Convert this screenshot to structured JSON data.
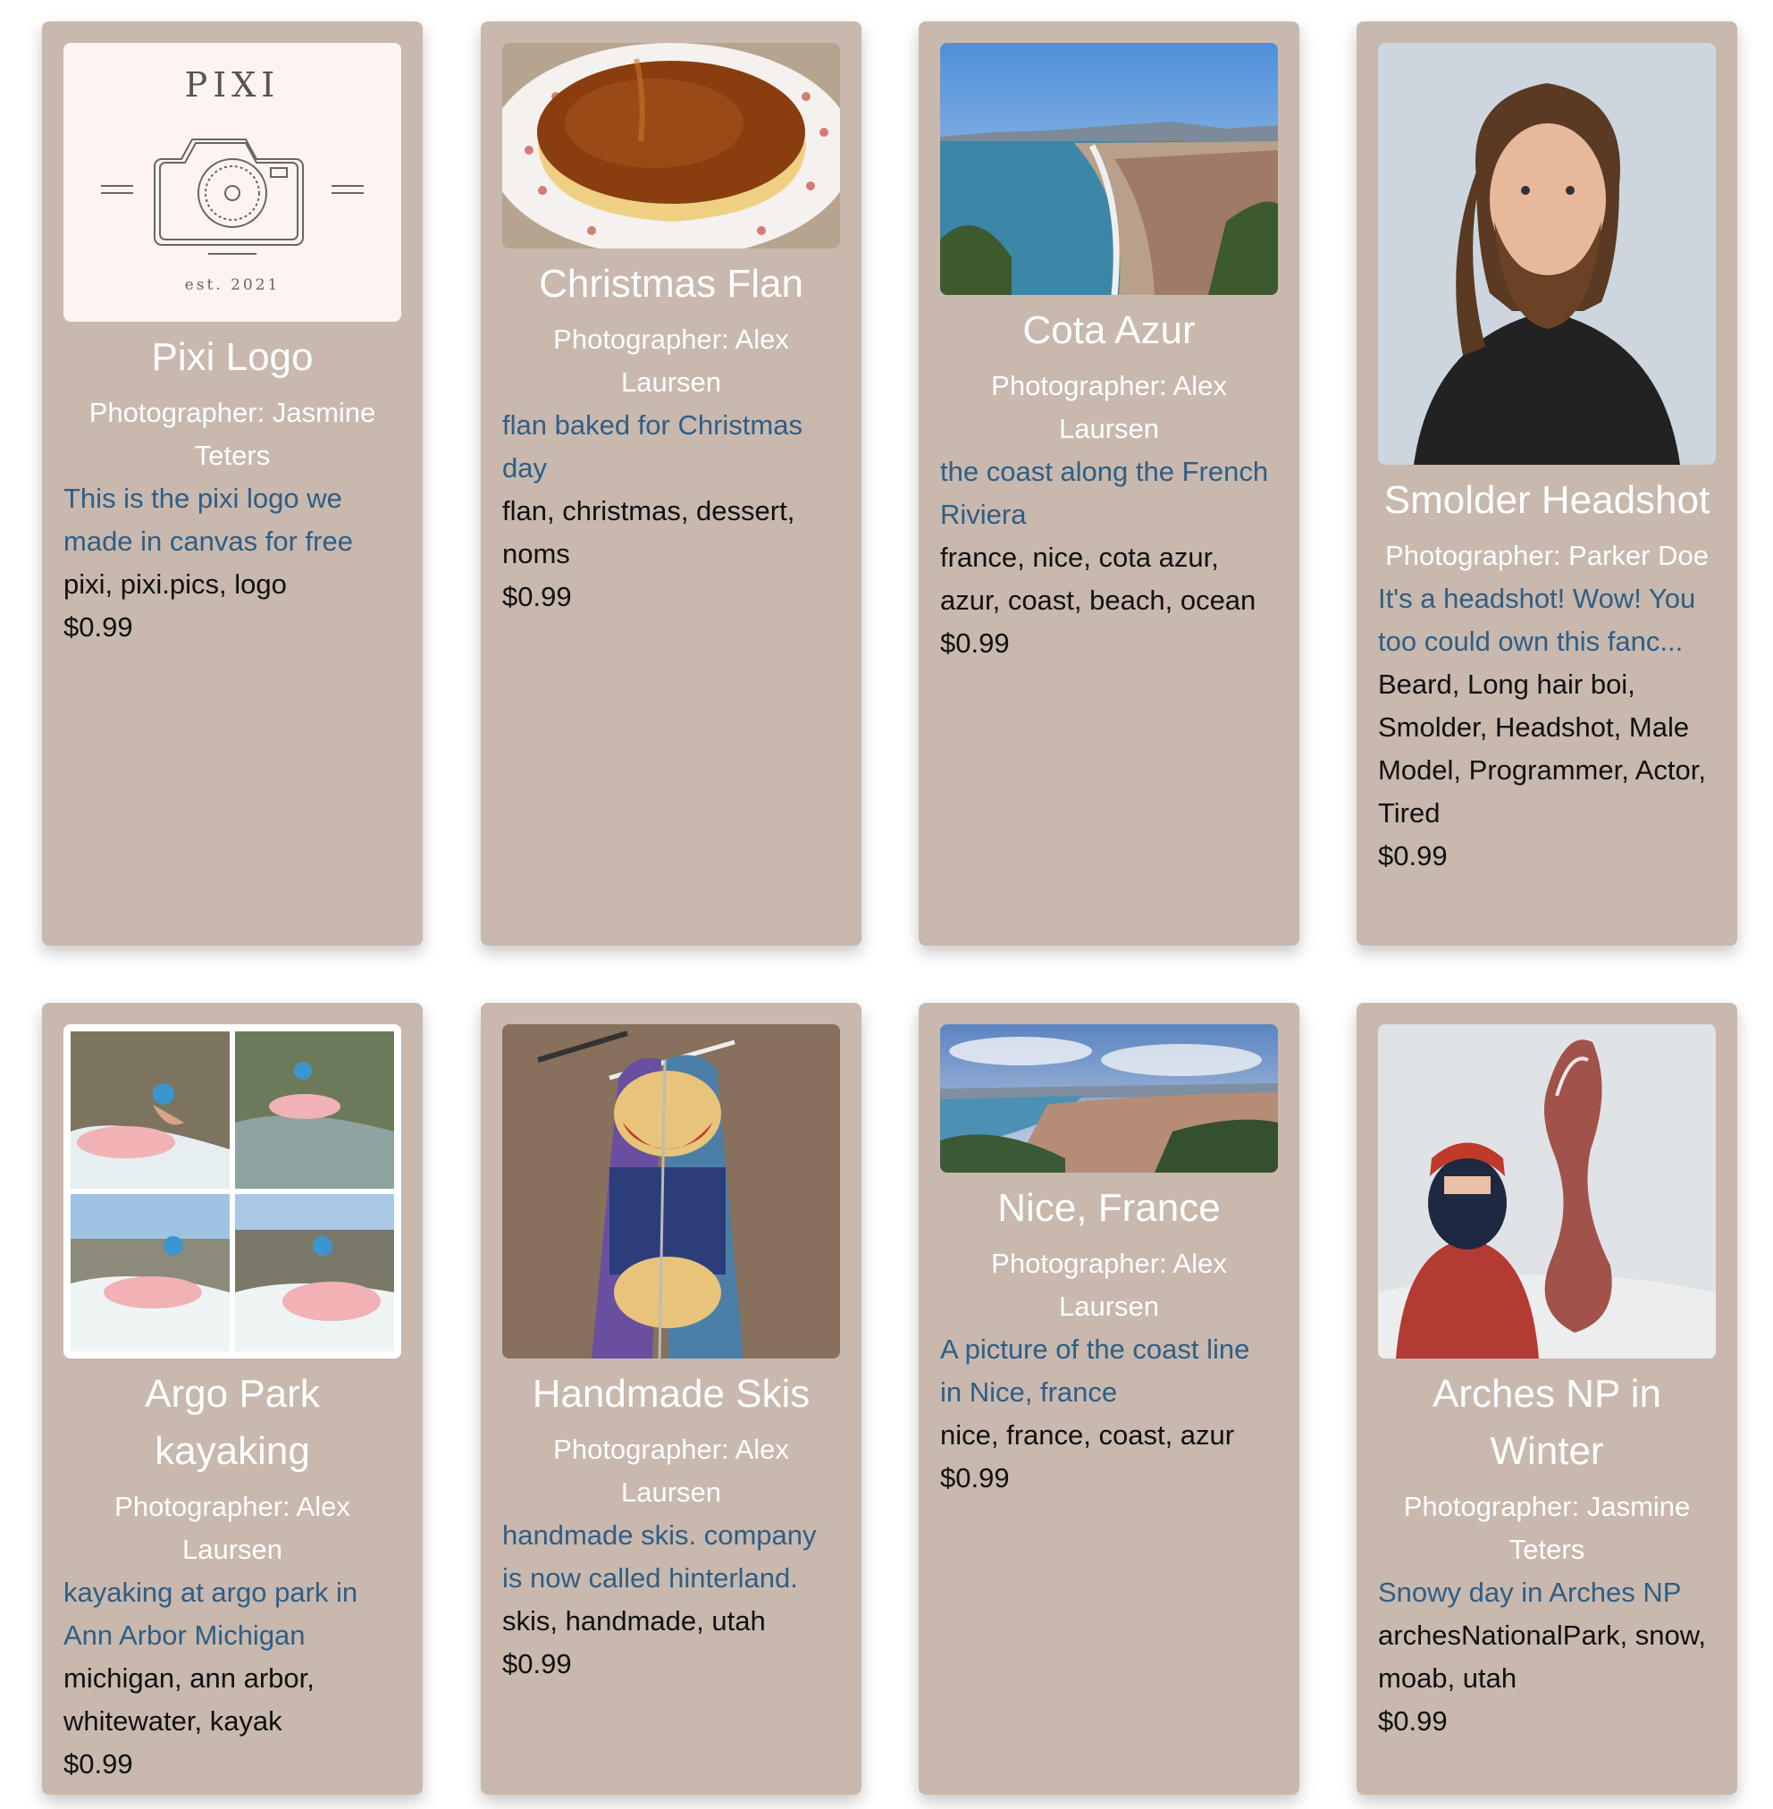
{
  "cards": [
    {
      "title": "Pixi Logo",
      "photographer": "Photographer: Jasmine Teters",
      "description": "This is the pixi logo we made in canvas for free",
      "tags": "pixi, pixi.pics, logo",
      "price": "$0.99",
      "logo_top": "PIXI",
      "logo_bottom": "est. 2021",
      "image_icon": "pixi-logo-image"
    },
    {
      "title": "Christmas Flan",
      "photographer": "Photographer: Alex Laursen",
      "description": "flan baked for Christmas day",
      "tags": "flan, christmas, dessert, noms",
      "price": "$0.99",
      "image_icon": "flan-photo"
    },
    {
      "title": "Cota Azur",
      "photographer": "Photographer: Alex Laursen",
      "description": "the coast along the French Riviera",
      "tags": "france, nice, cota azur, azur, coast, beach, ocean",
      "price": "$0.99",
      "image_icon": "coast-photo"
    },
    {
      "title": "Smolder Headshot",
      "photographer": "Photographer: Parker Doe",
      "description": "It's a headshot! Wow! You too could own this fanc...",
      "tags": "Beard, Long hair boi, Smolder, Headshot, Male Model, Programmer, Actor, Tired",
      "price": "$0.99",
      "image_icon": "headshot-photo"
    },
    {
      "title": "Argo Park kayaking",
      "photographer": "Photographer: Alex Laursen",
      "description": "kayaking at argo park in Ann Arbor Michigan",
      "tags": "michigan, ann arbor, whitewater, kayak",
      "price": "$0.99",
      "image_icon": "kayak-collage-photo"
    },
    {
      "title": "Handmade Skis",
      "photographer": "Photographer: Alex Laursen",
      "description": "handmade skis. company is now called hinterland.",
      "tags": "skis, handmade, utah",
      "price": "$0.99",
      "image_icon": "skis-photo"
    },
    {
      "title": "Nice, France",
      "photographer": "Photographer: Alex Laursen",
      "description": "A picture of the coast line in Nice, france",
      "tags": "nice, france, coast, azur",
      "price": "$0.99",
      "image_icon": "nice-panorama-photo"
    },
    {
      "title": "Arches NP in Winter",
      "photographer": "Photographer: Jasmine Teters",
      "description": "Snowy day in Arches NP",
      "tags": "archesNationalPark, snow, moab, utah",
      "price": "$0.99",
      "image_icon": "arches-winter-photo"
    }
  ],
  "colors": {
    "card_bg": "#c8b8ad",
    "title": "#ffffff",
    "description": "#2f5e86",
    "text": "#111111"
  }
}
